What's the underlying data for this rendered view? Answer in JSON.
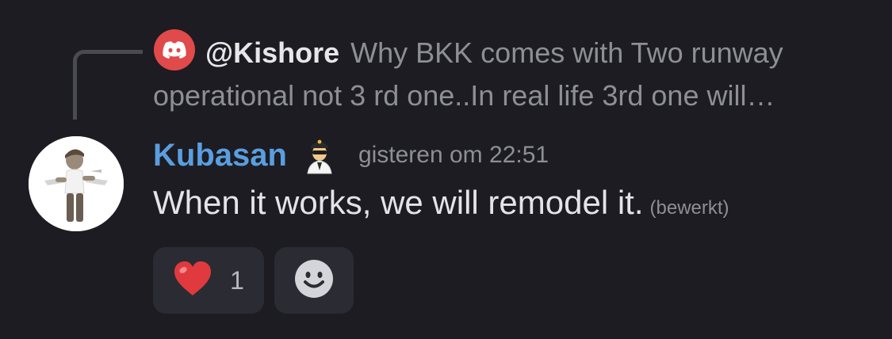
{
  "reply": {
    "icon": "discord-logo-icon",
    "icon_color": "#e04a4a",
    "author": "@Kishore",
    "preview": "Why BKK comes with Two runway operational not 3 rd one..In real life 3rd one will…"
  },
  "message": {
    "avatar": "avatar",
    "username": "Kubasan",
    "username_color": "#5a9ee0",
    "badge": "police-officer-icon",
    "timestamp": "gisteren om 22:51",
    "text": "When it works, we will remodel it.",
    "edited_label": "(bewerkt)"
  },
  "reactions": [
    {
      "emoji": "❤️",
      "icon": "red-heart-icon",
      "count": "1"
    }
  ],
  "add_reaction": {
    "icon": "smiley-icon"
  },
  "colors": {
    "background": "#1c1c22",
    "reaction_bg": "#2b2c33"
  }
}
